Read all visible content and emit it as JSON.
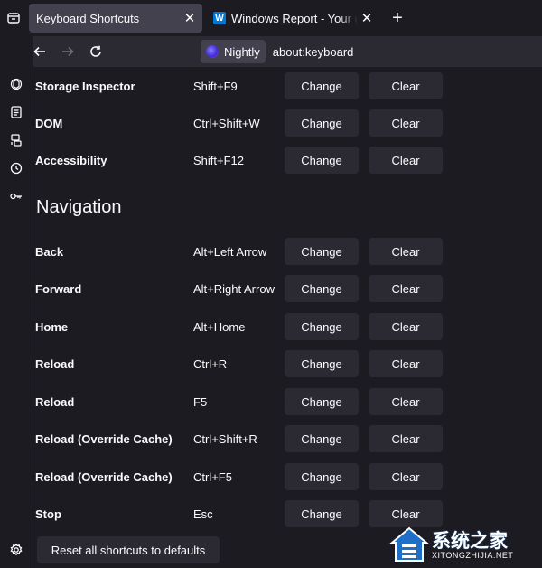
{
  "tabs": [
    {
      "title": "Keyboard Shortcuts",
      "active": true
    },
    {
      "title": "Windows Report - Your go-to source",
      "active": false,
      "favicon": "W"
    }
  ],
  "navbar": {
    "identity_label": "Nightly",
    "url": "about:keyboard"
  },
  "icons": {
    "sidebar_toggle": "sidebar-icon",
    "tabs_folder": "tab-folder-icon",
    "ai_chat": "openai-icon",
    "bookmarks": "document-icon",
    "synced_tabs": "devices-icon",
    "history": "clock-icon",
    "passwords": "key-icon",
    "settings": "gear-icon"
  },
  "shortcuts_top": [
    {
      "name": "Storage Inspector",
      "keys": "Shift+F9"
    },
    {
      "name": "DOM",
      "keys": "Ctrl+Shift+W"
    },
    {
      "name": "Accessibility",
      "keys": "Shift+F12"
    }
  ],
  "section_title": "Navigation",
  "shortcuts_nav": [
    {
      "name": "Back",
      "keys": "Alt+Left Arrow"
    },
    {
      "name": "Forward",
      "keys": "Alt+Right Arrow"
    },
    {
      "name": "Home",
      "keys": "Alt+Home"
    },
    {
      "name": "Reload",
      "keys": "Ctrl+R"
    },
    {
      "name": "Reload",
      "keys": "F5"
    },
    {
      "name": "Reload (Override Cache)",
      "keys": "Ctrl+Shift+R"
    },
    {
      "name": "Reload (Override Cache)",
      "keys": "Ctrl+F5"
    },
    {
      "name": "Stop",
      "keys": "Esc"
    }
  ],
  "buttons": {
    "change_label": "Change",
    "clear_label": "Clear",
    "reset_label": "Reset all shortcuts to defaults"
  },
  "watermark": {
    "text": "系统之家",
    "sub": "XITONGZHIJIA.NET"
  }
}
